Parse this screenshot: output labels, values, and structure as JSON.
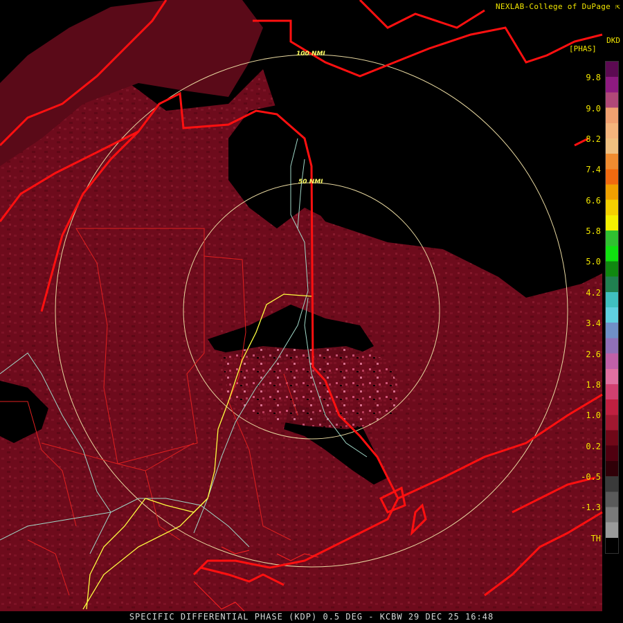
{
  "header": {
    "credit": "NEXLAB-College of DuPage",
    "credit_icon": "external-link-icon"
  },
  "legend": {
    "product_code": "DKD",
    "unit": "[PHAS]",
    "labels": [
      "9.8",
      "9.0",
      "8.2",
      "7.4",
      "6.6",
      "5.8",
      "5.0",
      "4.2",
      "3.4",
      "2.6",
      "1.8",
      "1.0",
      "0.2",
      "-0.5",
      "-1.3",
      "TH"
    ],
    "colors": [
      "#5c0a52",
      "#8e1a80",
      "#b04878",
      "#f0a070",
      "#f4b47c",
      "#f0c080",
      "#f08c30",
      "#f06a10",
      "#f0a000",
      "#f4d000",
      "#f4f000",
      "#30c030",
      "#10e010",
      "#108810",
      "#208050",
      "#40c0c0",
      "#60d0e0",
      "#7090c8",
      "#9070b8",
      "#c060a8",
      "#e070a0",
      "#d04070",
      "#c02040",
      "#a01830",
      "#700818",
      "#500010",
      "#300008",
      "#3a3a3a",
      "#5a5a5a",
      "#7a7a7a",
      "#9a9a9a",
      "#000000"
    ]
  },
  "map": {
    "ring_labels": [
      "100 NMI",
      "50 NMI"
    ],
    "colors": {
      "background": "#000000",
      "echo": "#6e0b1c",
      "state_borders": "#ff1010",
      "county_borders": "#e02020",
      "rings": "#e8d8a0",
      "highways": "#ffff40",
      "rivers": "#a0d8c8"
    }
  },
  "footer": {
    "caption": "SPECIFIC DIFFERENTIAL PHASE (KDP) 0.5 DEG - KCBW 29 DEC 25 16:48"
  }
}
